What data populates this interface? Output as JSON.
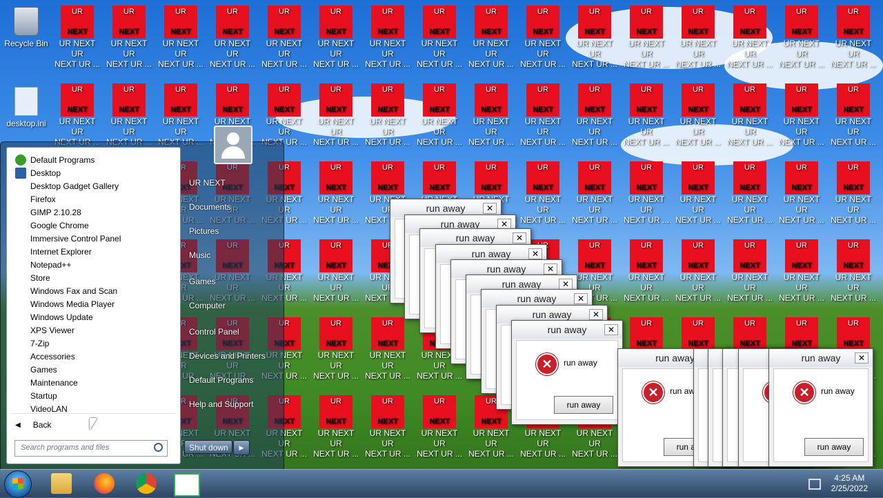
{
  "desktop": {
    "system_icons": [
      {
        "label": "Recycle Bin"
      },
      {
        "label": "desktop.ini"
      }
    ],
    "spam_icon": {
      "icon_top_text": "UR",
      "icon_bottom_text": "NEXT",
      "label_line1": "UR NEXT UR",
      "label_line2": "NEXT UR ...",
      "color": "#e8101e"
    }
  },
  "start_menu": {
    "programs": [
      "Default Programs",
      "Desktop",
      "Desktop Gadget Gallery",
      "Firefox",
      "GIMP 2.10.28",
      "Google Chrome",
      "Immersive Control Panel",
      "Internet Explorer",
      "Notepad++",
      "Store",
      "Windows Fax and Scan",
      "Windows Media Player",
      "Windows Update",
      "XPS Viewer",
      "7-Zip",
      "Accessories",
      "Games",
      "Maintenance",
      "Startup",
      "VideoLAN"
    ],
    "back_label": "Back",
    "search_placeholder": "Search programs and files",
    "right_links": [
      "UR NEXT",
      "Documents",
      "Pictures",
      "Music",
      "Games",
      "Computer",
      "Control Panel",
      "Devices and Printers",
      "Default Programs",
      "Help and Support"
    ],
    "shutdown_label": "Shut down"
  },
  "dialogs": {
    "title": "run away",
    "message": "run away",
    "button": "run away"
  },
  "taskbar": {
    "time": "4:25 AM",
    "date": "2/25/2022",
    "pinned": [
      "file-explorer-icon",
      "firefox-icon",
      "chrome-icon",
      "app-window-icon"
    ]
  },
  "colors": {
    "spam_red": "#e8101e",
    "error_red": "#c8202a",
    "taskbar": "#2c4662"
  }
}
